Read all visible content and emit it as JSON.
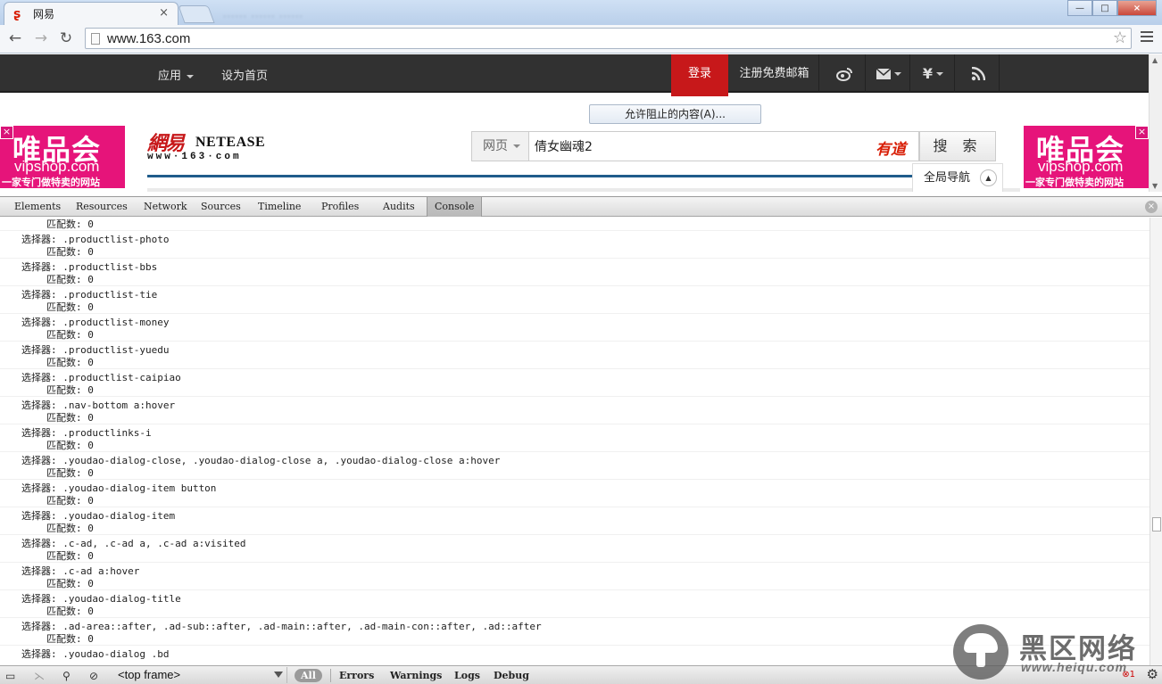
{
  "browser": {
    "tab_title": "网易",
    "tab_close": "×",
    "blurred_tabs": "...... ...... ......",
    "url": "www.163.com",
    "window_buttons": {
      "minimize": "—",
      "maximize": "□",
      "close": "×"
    },
    "nav": {
      "back": "←",
      "forward": "→",
      "reload": "↻",
      "star": "☆"
    }
  },
  "page": {
    "topnav": {
      "apps": "应用",
      "set_home": "设为首页",
      "login": "登录",
      "register": "注册免费邮箱",
      "icons": [
        "weibo-icon",
        "mail-icon",
        "yuan-icon",
        "rss-icon"
      ]
    },
    "popup_blocked": "允许阻止的内容(A)...",
    "ad": {
      "brand": "唯品会",
      "url": "vipshop.com",
      "slogan": "一家专门做特卖的网站",
      "close": "×"
    },
    "logo": {
      "cn": "網易",
      "en": "NETEASE",
      "domain": "www·163·com"
    },
    "search": {
      "type": "网页",
      "query": "倩女幽魂2",
      "provider": "有道",
      "button": "搜 索"
    },
    "global_nav": "全局导航"
  },
  "devtools": {
    "tabs": [
      "Elements",
      "Resources",
      "Network",
      "Sources",
      "Timeline",
      "Profiles",
      "Audits",
      "Console"
    ],
    "active_tab": "Console",
    "console_entries": [
      {
        "selector": "选择器: .productlist-yuedu",
        "count": "匹配数: 0"
      },
      {
        "selector": "选择器: .productlist-photo",
        "count": "匹配数: 0"
      },
      {
        "selector": "选择器: .productlist-bbs",
        "count": "匹配数: 0"
      },
      {
        "selector": "选择器: .productlist-tie",
        "count": "匹配数: 0"
      },
      {
        "selector": "选择器: .productlist-money",
        "count": "匹配数: 0"
      },
      {
        "selector": "选择器: .productlist-yuedu",
        "count": "匹配数: 0"
      },
      {
        "selector": "选择器: .productlist-caipiao",
        "count": "匹配数: 0"
      },
      {
        "selector": "选择器: .nav-bottom a:hover",
        "count": "匹配数: 0"
      },
      {
        "selector": "选择器: .productlinks-i",
        "count": "匹配数: 0"
      },
      {
        "selector": "选择器: .youdao-dialog-close, .youdao-dialog-close a, .youdao-dialog-close a:hover",
        "count": "匹配数: 0"
      },
      {
        "selector": "选择器: .youdao-dialog-item button",
        "count": "匹配数: 0"
      },
      {
        "selector": "选择器: .youdao-dialog-item",
        "count": "匹配数: 0"
      },
      {
        "selector": "选择器: .c-ad, .c-ad a, .c-ad a:visited",
        "count": "匹配数: 0"
      },
      {
        "selector": "选择器: .c-ad a:hover",
        "count": "匹配数: 0"
      },
      {
        "selector": "选择器: .youdao-dialog-title",
        "count": "匹配数: 0"
      },
      {
        "selector": "选择器: .ad-area::after, .ad-sub::after, .ad-main::after, .ad-main-con::after, .ad::after",
        "count": "匹配数: 0"
      },
      {
        "selector": "选择器: .youdao-dialog .bd",
        "count": ""
      }
    ],
    "bottom": {
      "frame": "<top frame>",
      "filters": [
        "All",
        "Errors",
        "Warnings",
        "Logs",
        "Debug"
      ],
      "error_count": "1"
    }
  },
  "watermark": {
    "cn": "黑区网络",
    "url": "www.heiqu.com"
  }
}
